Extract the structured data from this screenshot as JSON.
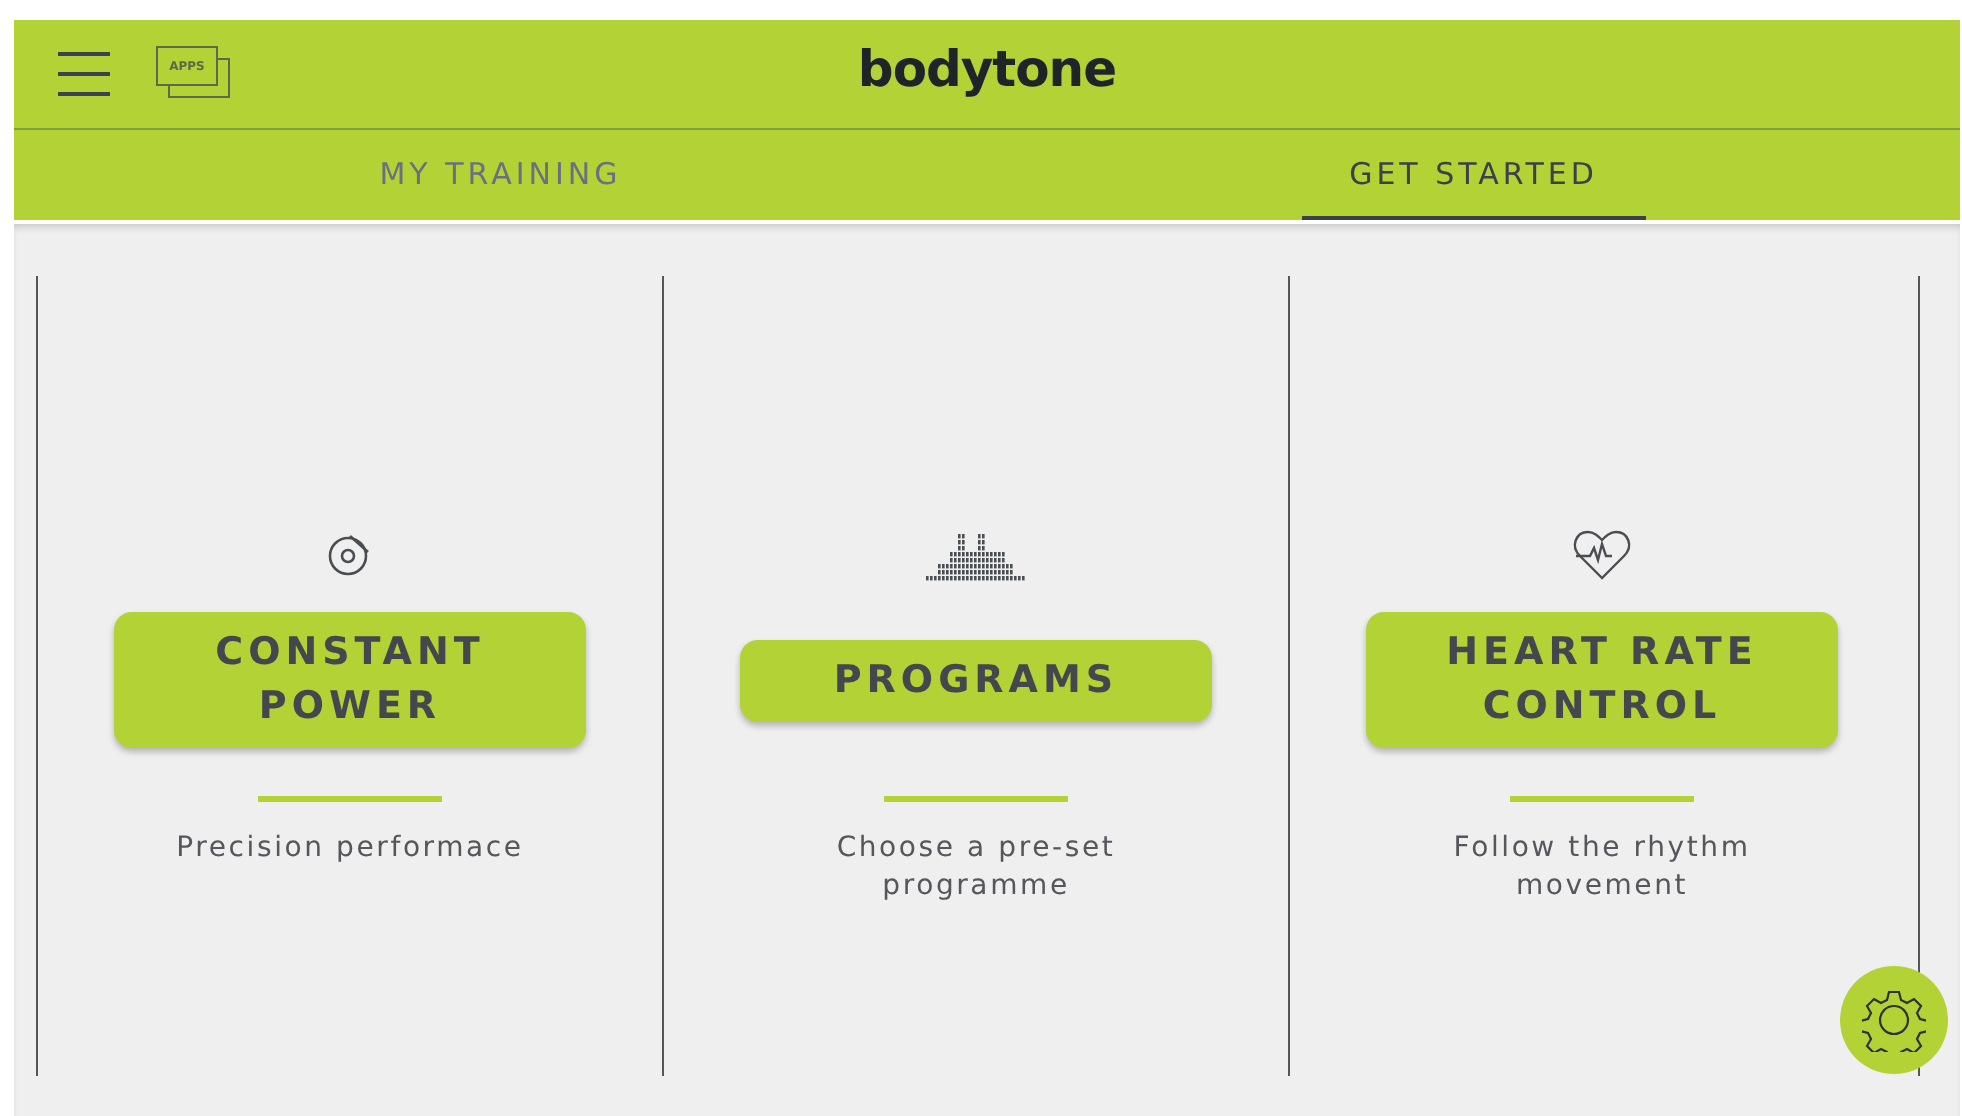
{
  "header": {
    "logo": "bodytone",
    "apps_label": "APPS"
  },
  "tabs": [
    {
      "label": "MY TRAINING",
      "selected": false
    },
    {
      "label": "GET STARTED",
      "selected": true
    }
  ],
  "modes": [
    {
      "kind": "power",
      "title": "CONSTANT POWER",
      "description": "Precision performace"
    },
    {
      "kind": "programs",
      "title": "PROGRAMS",
      "description": "Choose a pre-set programme"
    },
    {
      "kind": "heart",
      "title": "HEART RATE CONTROL",
      "description": "Follow the rhythm movement"
    }
  ]
}
